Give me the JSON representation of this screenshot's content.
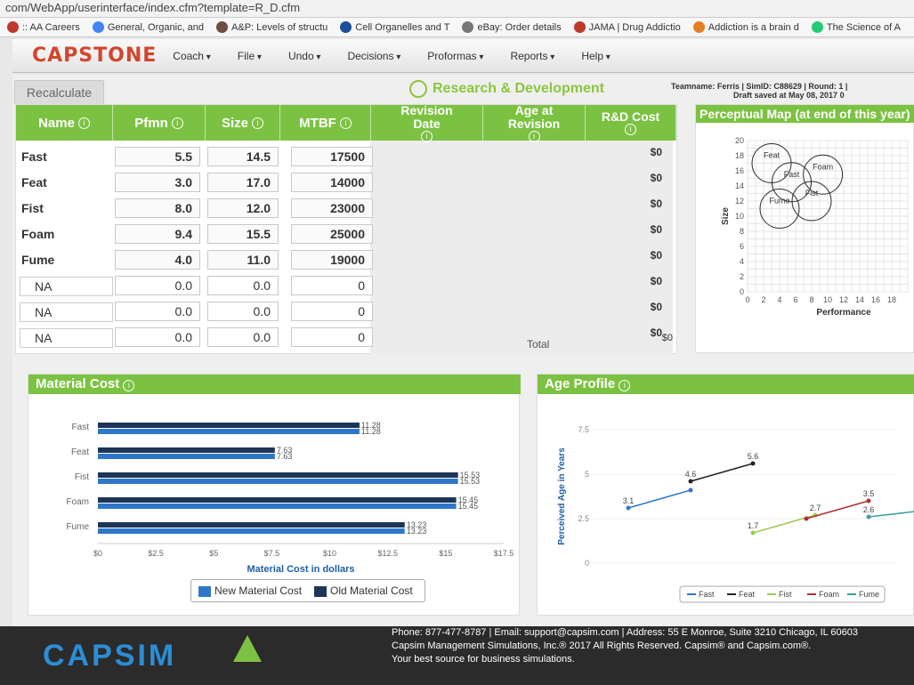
{
  "browser": {
    "url": "com/WebApp/userinterface/index.cfm?template=R_D.cfm",
    "bookmarks": [
      ":: AA Careers",
      "General, Organic, and",
      "A&P: Levels of structu",
      "Cell Organelles and T",
      "eBay: Order details",
      "JAMA | Drug Addictio",
      "Addiction is a brain d",
      "The Science of A"
    ]
  },
  "nav": {
    "logo": "CAPSTONE",
    "menu": [
      "Coach",
      "File",
      "Undo",
      "Decisions",
      "Proformas",
      "Reports",
      "Help"
    ]
  },
  "page": {
    "recalculate": "Recalculate",
    "title": "Research & Development",
    "team_line": "Teamname: Ferris | SimID: C88629 | Round: 1 |",
    "draft_line": "Draft saved at May 08, 2017 0"
  },
  "table": {
    "headers": [
      "Name",
      "Pfmn",
      "Size",
      "MTBF",
      "Revision Date",
      "Age at Revision",
      "R&D Cost"
    ],
    "rows": [
      {
        "name": "Fast",
        "pfmn": "5.5",
        "size": "14.5",
        "mtbf": "17500",
        "cost": "$0"
      },
      {
        "name": "Feat",
        "pfmn": "3.0",
        "size": "17.0",
        "mtbf": "14000",
        "cost": "$0"
      },
      {
        "name": "Fist",
        "pfmn": "8.0",
        "size": "12.0",
        "mtbf": "23000",
        "cost": "$0"
      },
      {
        "name": "Foam",
        "pfmn": "9.4",
        "size": "15.5",
        "mtbf": "25000",
        "cost": "$0"
      },
      {
        "name": "Fume",
        "pfmn": "4.0",
        "size": "11.0",
        "mtbf": "19000",
        "cost": "$0"
      },
      {
        "name": "NA",
        "pfmn": "0.0",
        "size": "0.0",
        "mtbf": "0",
        "cost": "$0"
      },
      {
        "name": "NA",
        "pfmn": "0.0",
        "size": "0.0",
        "mtbf": "0",
        "cost": "$0"
      },
      {
        "name": "NA",
        "pfmn": "0.0",
        "size": "0.0",
        "mtbf": "0",
        "cost": "$0"
      }
    ],
    "total_label": "Total",
    "total_value": "$0"
  },
  "perceptual": {
    "title": "Perceptual Map (at end of this year)"
  },
  "material": {
    "title": "Material Cost"
  },
  "age": {
    "title": "Age Profile"
  },
  "chart_data": [
    {
      "type": "scatter",
      "title": "Perceptual Map (at end of this year)",
      "xlabel": "Performance",
      "ylabel": "Size",
      "xlim": [
        0,
        20
      ],
      "ylim": [
        0,
        20
      ],
      "xticks": [
        "0",
        "2",
        "4",
        "6",
        "8",
        "10",
        "12",
        "14",
        "16",
        "18"
      ],
      "yticks": [
        "0",
        "2",
        "4",
        "6",
        "8",
        "10",
        "12",
        "14",
        "16",
        "18",
        "20"
      ],
      "points": [
        {
          "name": "Feat",
          "x": 3.0,
          "y": 17.0
        },
        {
          "name": "Foam",
          "x": 9.4,
          "y": 15.5
        },
        {
          "name": "Fast",
          "x": 5.5,
          "y": 14.5
        },
        {
          "name": "Fist",
          "x": 8.0,
          "y": 12.0
        },
        {
          "name": "Fume",
          "x": 4.0,
          "y": 11.0
        }
      ],
      "grid": true
    },
    {
      "type": "bar",
      "title": "Material Cost",
      "xlabel": "Material Cost in dollars",
      "xlim": [
        0,
        17.5
      ],
      "xticks": [
        "$0",
        "$2.5",
        "$5",
        "$7.5",
        "$10",
        "$12.5",
        "$15",
        "$17.5"
      ],
      "categories": [
        "Fast",
        "Feat",
        "Fist",
        "Foam",
        "Fume"
      ],
      "series": [
        {
          "name": "Old Material Cost",
          "color": "#1d3557",
          "values": [
            11.28,
            7.63,
            15.53,
            15.45,
            13.23
          ]
        },
        {
          "name": "New Material Cost",
          "color": "#2e77c8",
          "values": [
            11.28,
            7.63,
            15.53,
            15.45,
            13.23
          ]
        }
      ],
      "legend": "bottom"
    },
    {
      "type": "line",
      "title": "Age Profile",
      "ylabel": "Perceived Age in Years",
      "ylim": [
        0,
        7.5
      ],
      "yticks": [
        "0",
        "2.5",
        "5",
        "7.5"
      ],
      "series": [
        {
          "name": "Fast",
          "color": "#2e77c8",
          "values": [
            3.1,
            4.1
          ],
          "labels": [
            "3.1",
            ""
          ]
        },
        {
          "name": "Feat",
          "color": "#222222",
          "values": [
            4.6,
            5.6
          ],
          "labels": [
            "4.6",
            "5.6"
          ]
        },
        {
          "name": "Fist",
          "color": "#9ccc4c",
          "values": [
            1.7,
            2.7
          ],
          "labels": [
            "1.7",
            "2.7"
          ]
        },
        {
          "name": "Foam",
          "color": "#b03030",
          "values": [
            2.5,
            3.5
          ],
          "labels": [
            "",
            "3.5"
          ]
        },
        {
          "name": "Fume",
          "color": "#3aa0a0",
          "values": [
            2.6,
            3.0
          ],
          "labels": [
            "2.6",
            ""
          ]
        }
      ],
      "legend": "bottom"
    }
  ],
  "footer": {
    "logo": "CAPSIM",
    "line1": "Phone: 877-477-8787 | Email: support@capsim.com | Address: 55 E Monroe, Suite 3210 Chicago, IL 60603",
    "line2": "Capsim Management Simulations, Inc.® 2017  All Rights Reserved. Capsim® and Capsim.com®.",
    "line3": "Your best source for business simulations."
  }
}
